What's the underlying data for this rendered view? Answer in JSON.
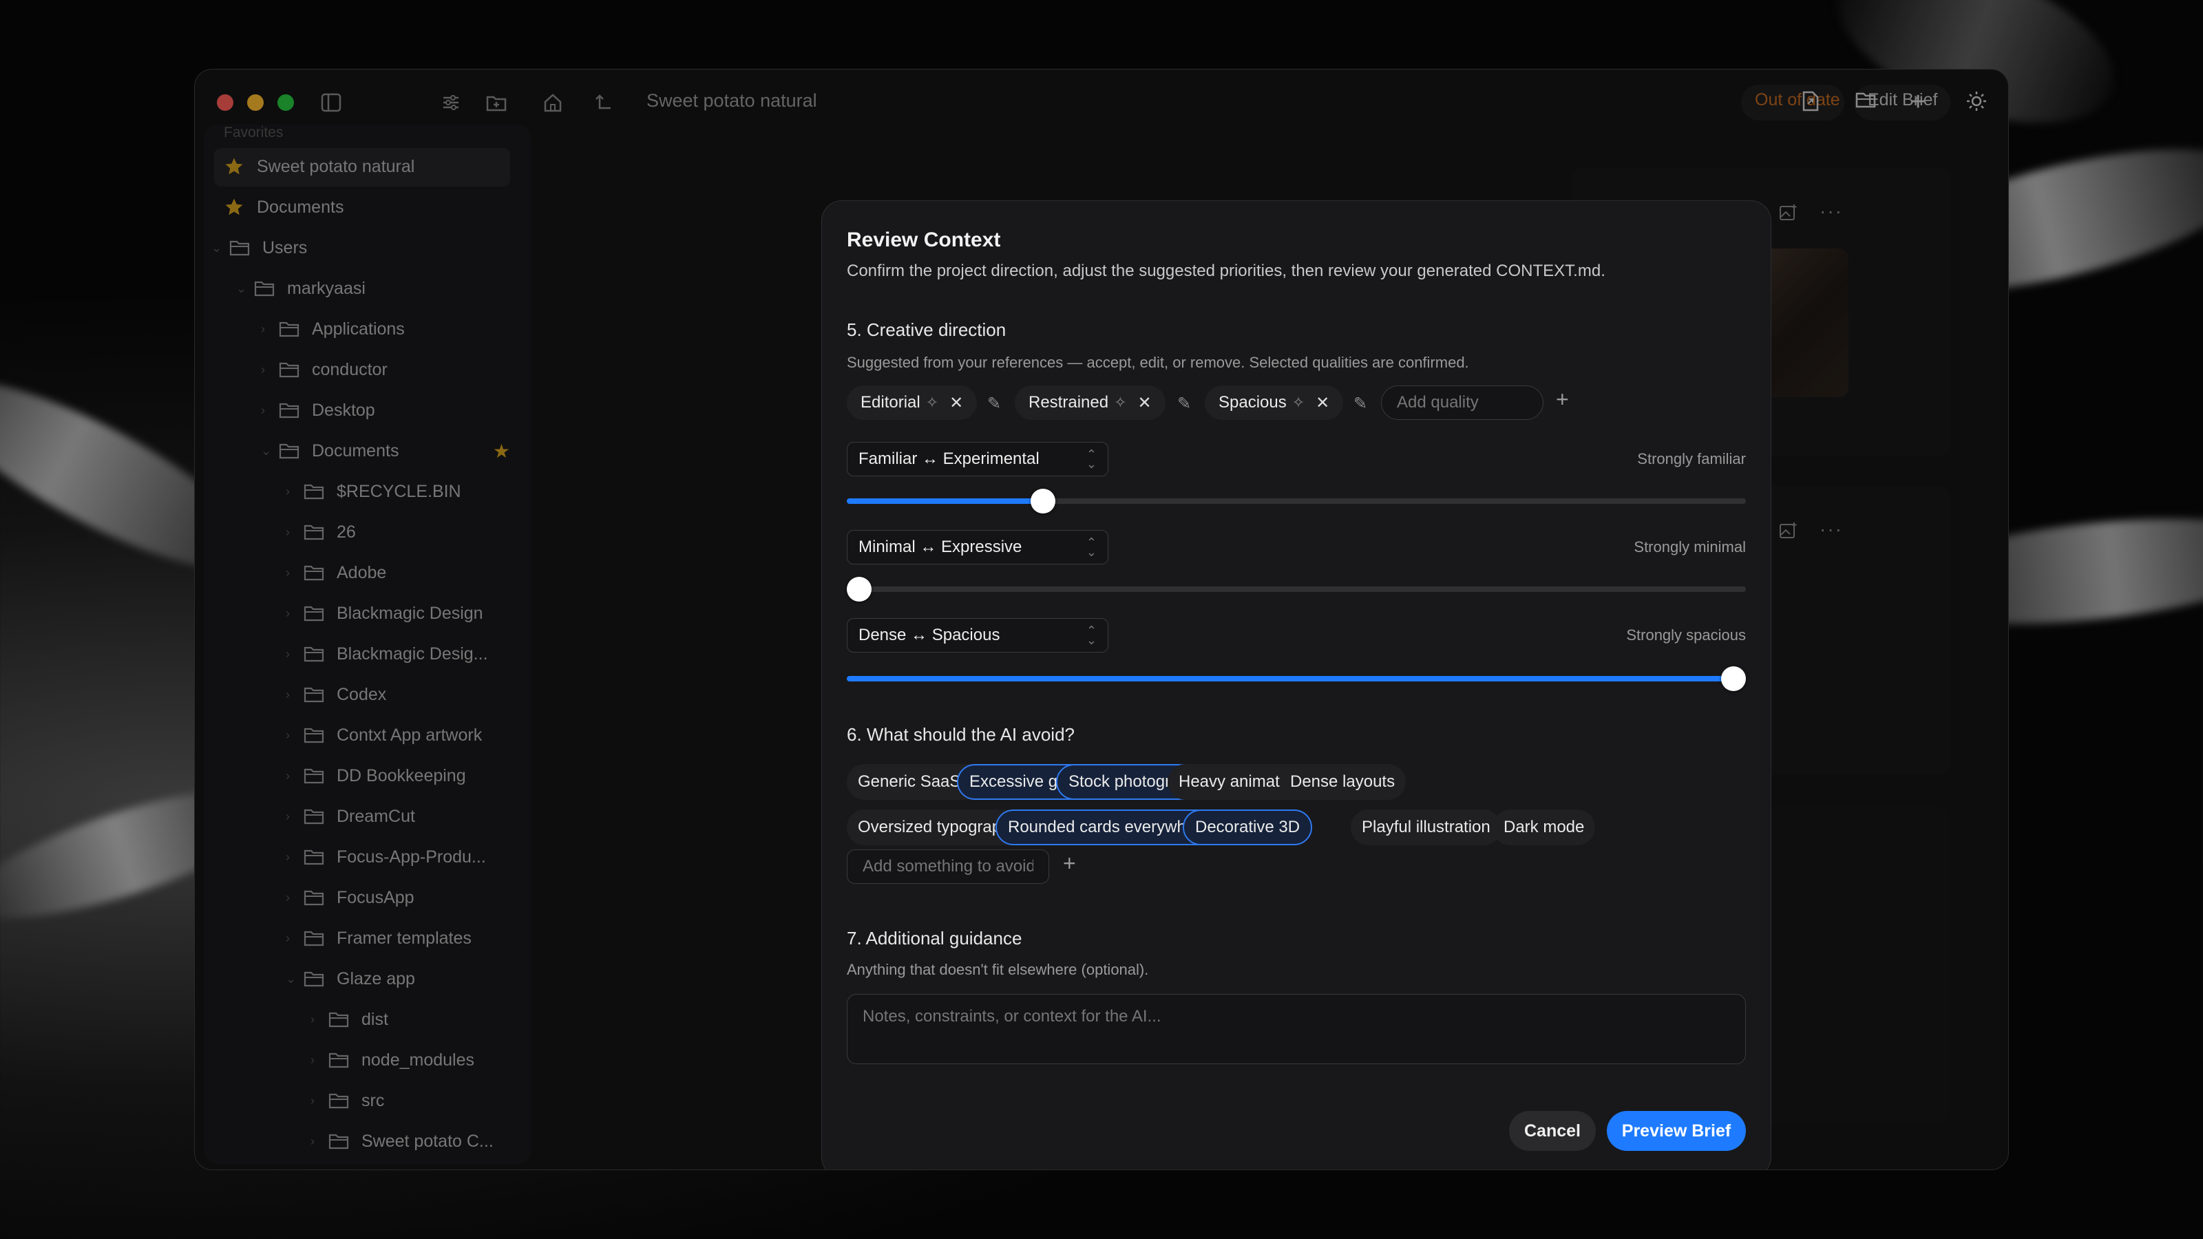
{
  "window": {
    "title": "Sweet potato natural",
    "status_text": "Out of date",
    "edit_brief_label": "Edit Brief"
  },
  "sidebar": {
    "favorites_label": "Favorites",
    "items": [
      {
        "label": "Sweet potato natural",
        "icon": "star-icon"
      },
      {
        "label": "Documents",
        "icon": "star-icon"
      },
      {
        "label": "Users",
        "icon": "folder-icon"
      },
      {
        "label": "markyaasi",
        "icon": "folder-icon"
      },
      {
        "label": "Applications",
        "icon": "folder-icon"
      },
      {
        "label": "conductor",
        "icon": "folder-icon"
      },
      {
        "label": "Desktop",
        "icon": "folder-icon"
      },
      {
        "label": "Documents",
        "icon": "folder-icon"
      },
      {
        "label": "$RECYCLE.BIN",
        "icon": "folder-icon"
      },
      {
        "label": "26",
        "icon": "folder-icon"
      },
      {
        "label": "Adobe",
        "icon": "folder-icon"
      },
      {
        "label": "Blackmagic Design",
        "icon": "folder-icon"
      },
      {
        "label": "Blackmagic Desig...",
        "icon": "folder-icon"
      },
      {
        "label": "Codex",
        "icon": "folder-icon"
      },
      {
        "label": "Contxt App artwork",
        "icon": "folder-icon"
      },
      {
        "label": "DD Bookkeeping",
        "icon": "folder-icon"
      },
      {
        "label": "DreamCut",
        "icon": "folder-icon"
      },
      {
        "label": "Focus-App-Produ...",
        "icon": "folder-icon"
      },
      {
        "label": "FocusApp",
        "icon": "folder-icon"
      },
      {
        "label": "Framer templates",
        "icon": "folder-icon"
      },
      {
        "label": "Glaze app",
        "icon": "folder-icon"
      },
      {
        "label": "dist",
        "icon": "folder-icon"
      },
      {
        "label": "node_modules",
        "icon": "folder-icon"
      },
      {
        "label": "src",
        "icon": "folder-icon"
      },
      {
        "label": "Sweet potato C...",
        "icon": "folder-icon"
      }
    ]
  },
  "modal": {
    "title": "Review Context",
    "subtitle": "Confirm the project direction, adjust the suggested priorities, then review your generated CONTEXT.md.",
    "section5": {
      "heading": "5. Creative direction",
      "description": "Suggested from your references — accept, edit, or remove. Selected qualities are confirmed.",
      "qualities": [
        "Editorial",
        "Restrained",
        "Spacious"
      ],
      "add_quality_placeholder": "Add quality",
      "sliders": [
        {
          "label": "Familiar ↔ Experimental",
          "strength": "Strongly familiar",
          "value": 0.21
        },
        {
          "label": "Minimal ↔ Expressive",
          "strength": "Strongly minimal",
          "value": 0.0
        },
        {
          "label": "Dense ↔ Spacious",
          "strength": "Strongly spacious",
          "value": 1.0
        }
      ]
    },
    "section6": {
      "heading": "6. What should the AI avoid?",
      "chips": [
        {
          "label": "Generic SaaS styling",
          "selected": false
        },
        {
          "label": "Excessive gradients",
          "selected": true
        },
        {
          "label": "Stock photography",
          "selected": true
        },
        {
          "label": "Heavy animation",
          "selected": false
        },
        {
          "label": "Dense layouts",
          "selected": false
        },
        {
          "label": "Oversized typography",
          "selected": false
        },
        {
          "label": "Rounded cards everywhere",
          "selected": true
        },
        {
          "label": "Decorative 3D",
          "selected": true
        },
        {
          "label": "Playful illustration",
          "selected": false
        },
        {
          "label": "Dark mode",
          "selected": false
        }
      ],
      "add_placeholder": "Add something to avoid"
    },
    "section7": {
      "heading": "7. Additional guidance",
      "description": "Anything that doesn't fit elsewhere (optional).",
      "placeholder": "Notes, constraints, or context for the AI..."
    },
    "cancel_label": "Cancel",
    "primary_label": "Preview Brief"
  },
  "colors": {
    "accent": "#1e7bff",
    "status": "#c2691e",
    "star": "#d4a020"
  }
}
